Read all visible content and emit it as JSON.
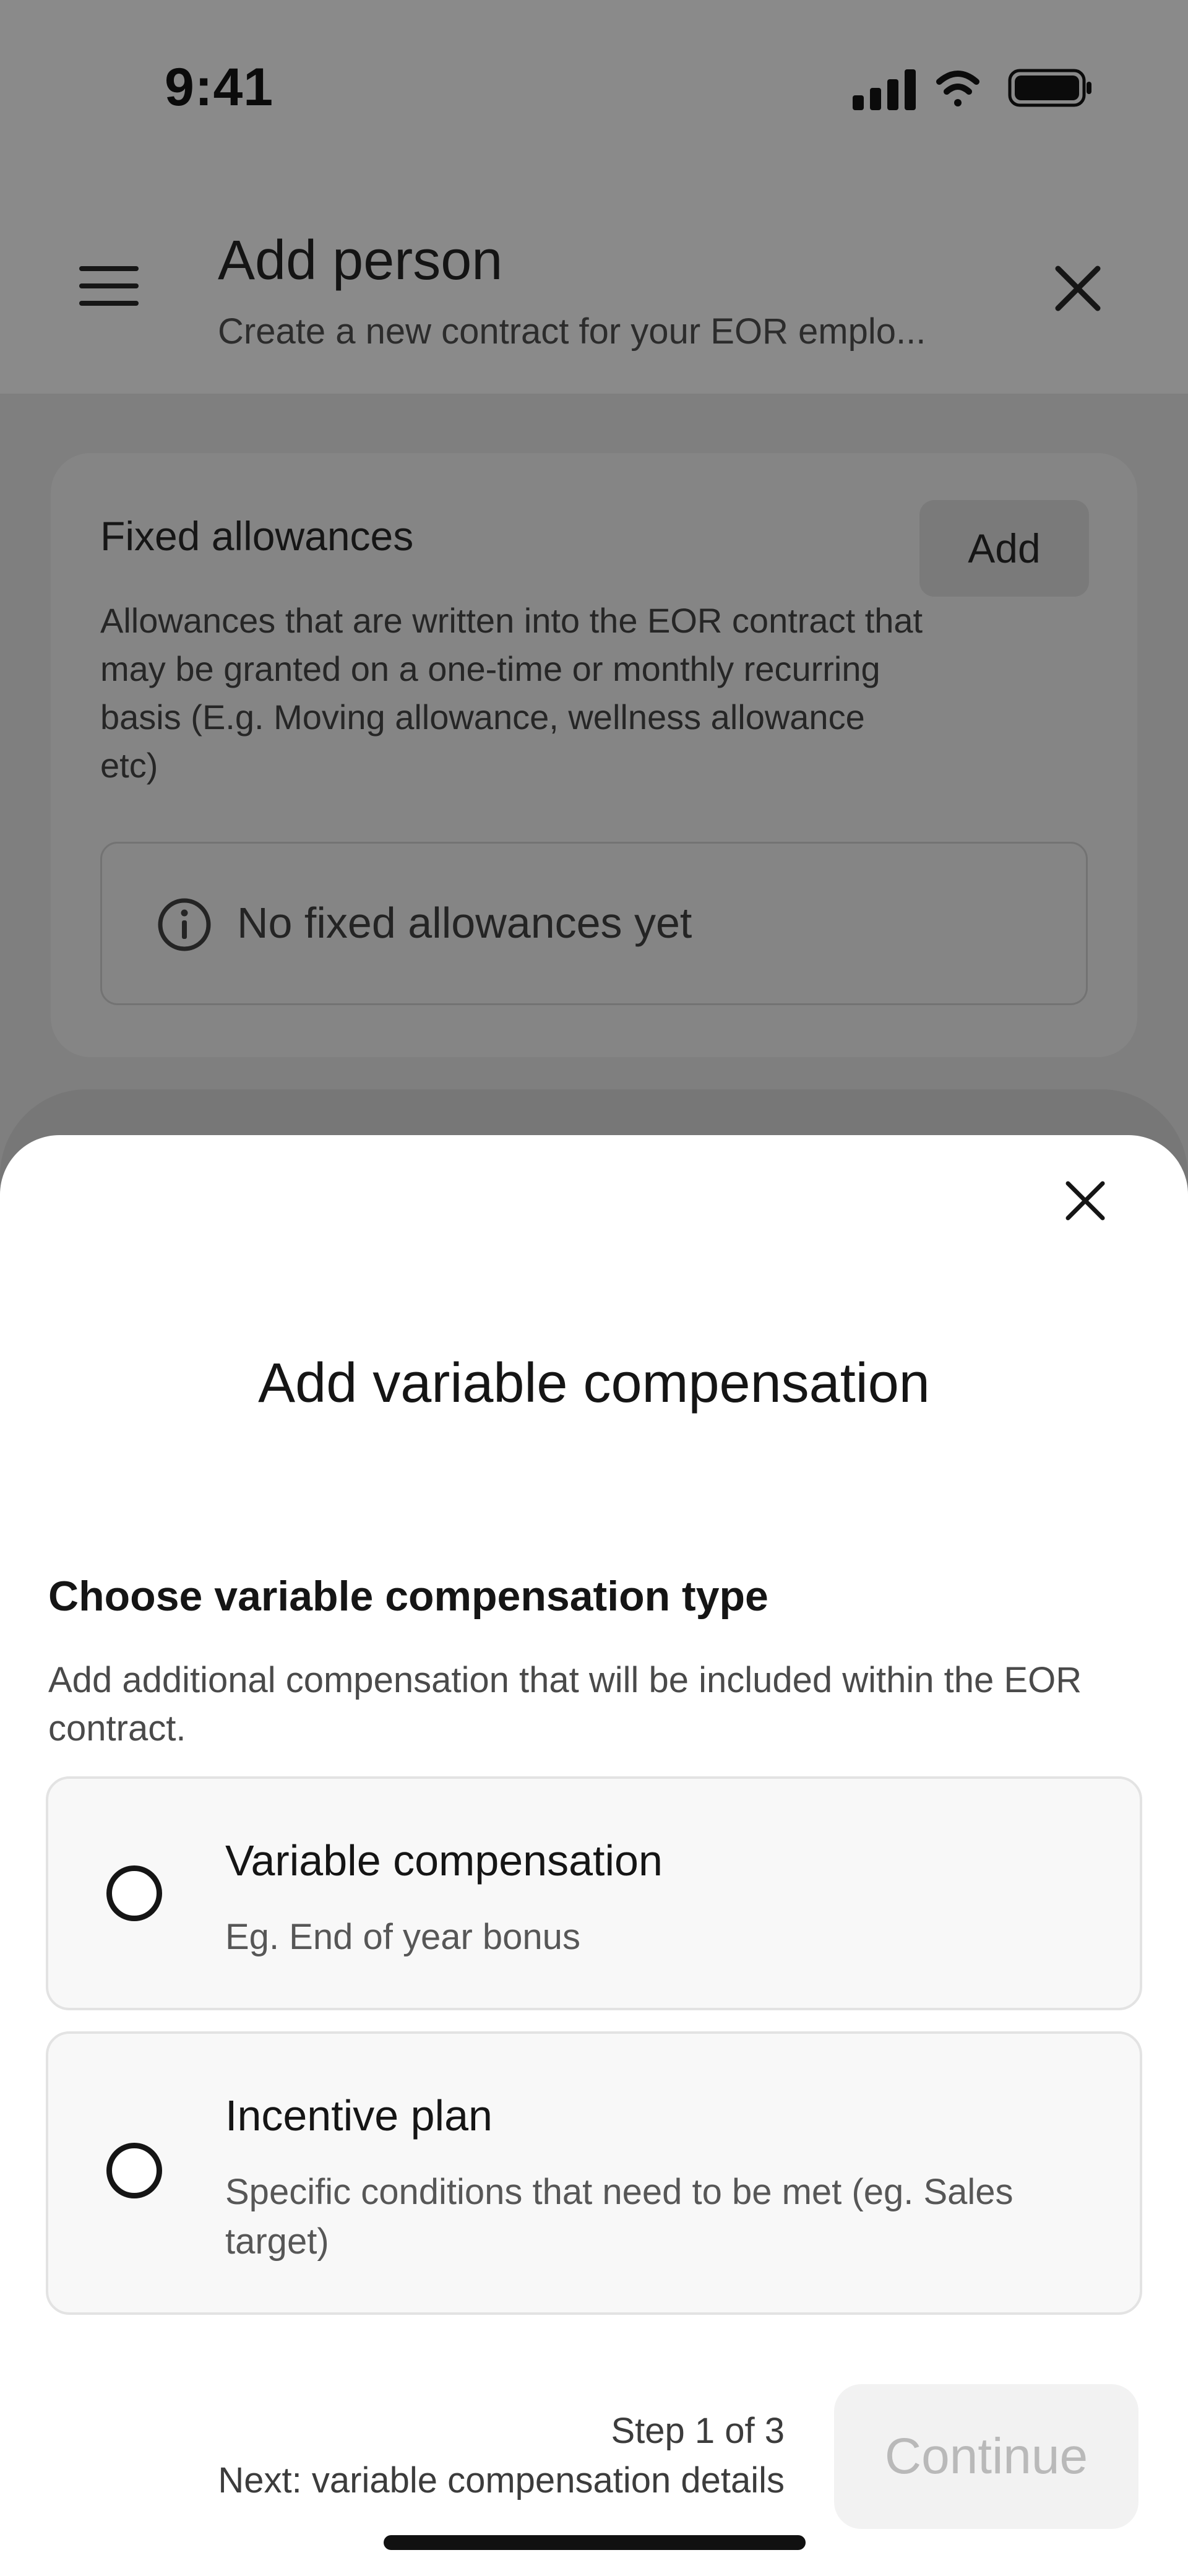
{
  "status_bar": {
    "time": "9:41",
    "icons": [
      "cellular-signal-icon",
      "wifi-icon",
      "battery-icon"
    ]
  },
  "header": {
    "menu_icon": "hamburger-icon",
    "title": "Add person",
    "subtitle": "Create a new contract for your EOR emplo...",
    "close_icon": "close-icon"
  },
  "fixed_allowances": {
    "title": "Fixed allowances",
    "add_label": "Add",
    "description": "Allowances that are written into the EOR contract that may be granted on a one-time or monthly recurring basis (E.g. Moving allowance, wellness allowance etc)",
    "empty_icon": "info-icon",
    "empty_text": "No fixed allowances yet"
  },
  "sheet": {
    "close_icon": "close-icon",
    "title": "Add variable compensation",
    "section_heading": "Choose variable compensation type",
    "section_description": "Add additional compensation that will be included within the EOR contract.",
    "options": [
      {
        "title": "Variable compensation",
        "subtitle": "Eg. End of year bonus",
        "selected": false
      },
      {
        "title": "Incentive plan",
        "subtitle": "Specific conditions that need to be met (eg. Sales target)",
        "selected": false
      }
    ],
    "footer": {
      "step": "Step 1 of 3",
      "next": "Next: variable compensation details",
      "continue_label": "Continue",
      "continue_enabled": false
    }
  },
  "colors": {
    "overlay": "#808080",
    "sheet_background": "#ffffff",
    "option_background": "#f8f8f8",
    "option_border": "#e3e3e3",
    "disabled_button": "#f2f2f2",
    "disabled_text": "#b9b9b9",
    "text_primary": "#151515"
  }
}
